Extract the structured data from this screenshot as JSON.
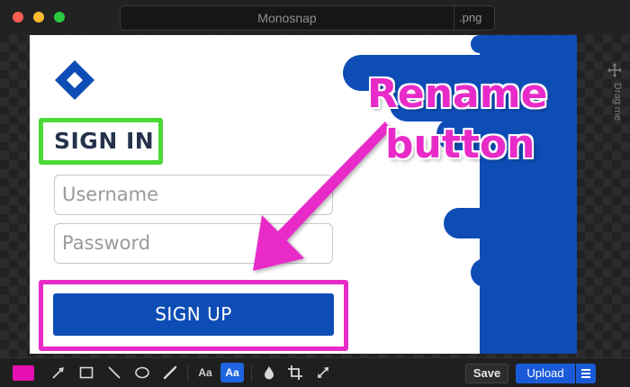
{
  "window": {
    "title": "Monosnap",
    "file_extension": ".png"
  },
  "drag_handle": {
    "label": "Drag me",
    "icon": "move-arrows-icon"
  },
  "screenshot": {
    "signin_heading": "SIGN IN",
    "username_placeholder": "Username",
    "password_placeholder": "Password",
    "signup_button": "SIGN UP",
    "annotation_line1": "Rename",
    "annotation_line2": "button",
    "annotation_color": "#e82bc8",
    "brand_color": "#0e4db6",
    "signin_highlight_color": "#4cd837"
  },
  "toolbar": {
    "color_swatch": "#e60fb0",
    "tools": [
      "arrow-icon",
      "rectangle-icon",
      "line-icon",
      "ellipse-icon",
      "pen-icon"
    ],
    "text_tool_label": "Aa",
    "text_styled_tool_label": "Aa",
    "extra_tools": [
      "blur-drop-icon",
      "crop-icon",
      "resize-icon"
    ],
    "save_label": "Save",
    "upload_label": "Upload",
    "menu_icon": "hamburger-icon"
  }
}
